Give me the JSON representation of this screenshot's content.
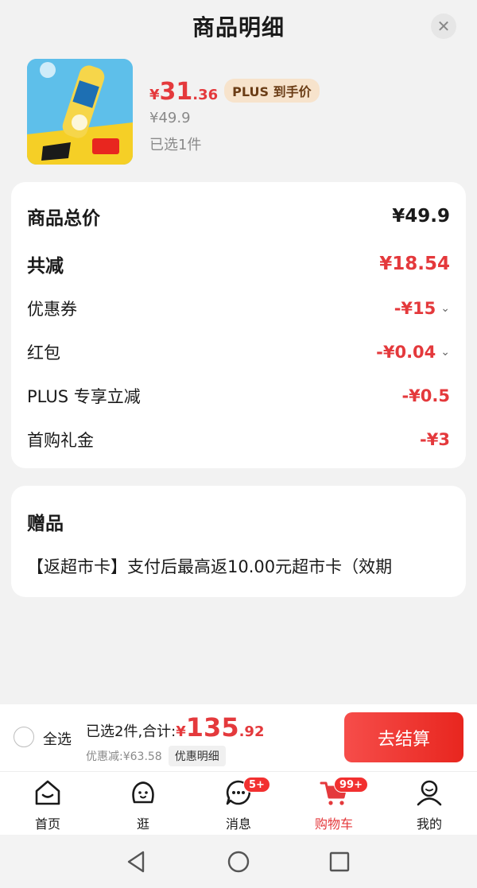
{
  "sheet": {
    "title": "商品明细",
    "close_icon": "close-icon"
  },
  "product": {
    "currency": "¥",
    "price_int": "31",
    "price_dec": ".36",
    "plus_tag": "PLUS 到手价",
    "original_price": "¥49.9",
    "selected": "已选1件"
  },
  "summary": {
    "rows": [
      {
        "label": "商品总价",
        "value": "¥49.9"
      },
      {
        "label": "共减",
        "value": "¥18.54"
      },
      {
        "label": "优惠券",
        "value": "-¥15"
      },
      {
        "label": "红包",
        "value": "-¥0.04"
      },
      {
        "label": "PLUS 专享立减",
        "value": "-¥0.5"
      },
      {
        "label": "首购礼金",
        "value": "-¥3"
      }
    ]
  },
  "gift": {
    "title": "赠品",
    "desc": "【返超市卡】支付后最高返10.00元超市卡（效期"
  },
  "checkout": {
    "select_all": "全选",
    "total_label": "已选2件,合计:",
    "currency": "¥",
    "total_int": "135",
    "total_dec": ".92",
    "discount": "优惠减:¥63.58",
    "detail_btn": "优惠明细",
    "pay_btn": "去结算"
  },
  "tabs": [
    {
      "label": "首页",
      "icon": "home-icon"
    },
    {
      "label": "逛",
      "icon": "browse-icon"
    },
    {
      "label": "消息",
      "icon": "message-icon",
      "badge": "5+"
    },
    {
      "label": "购物车",
      "icon": "cart-icon",
      "badge": "99+",
      "active": true
    },
    {
      "label": "我的",
      "icon": "profile-icon"
    }
  ],
  "colors": {
    "accent": "#e4393c",
    "plus_bg": "#f7e3cc",
    "plus_text": "#6b3d16"
  }
}
